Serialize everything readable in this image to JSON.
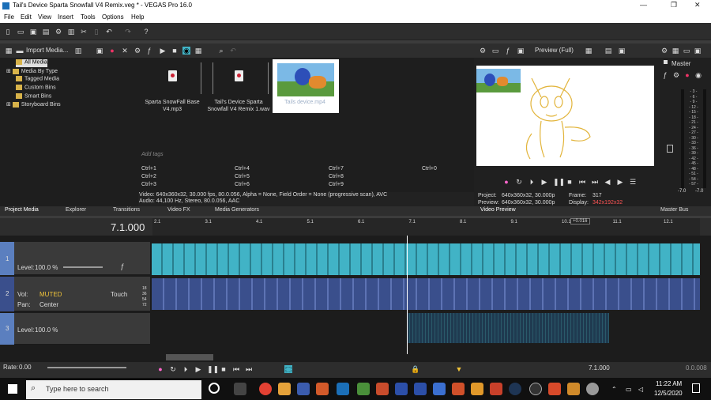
{
  "title": "Tail's Device Sparta Snowfall V4 Remix.veg * - VEGAS Pro 16.0",
  "menu": [
    "File",
    "Edit",
    "View",
    "Insert",
    "Tools",
    "Options",
    "Help"
  ],
  "project_media": {
    "import_label": "Import Media...",
    "tree": [
      "All Media",
      "Media By Type",
      "Tagged Media",
      "Custom Bins",
      "Smart Bins",
      "Storyboard Bins"
    ],
    "items": [
      {
        "name": "Sparta SnowFall Base V4.mp3"
      },
      {
        "name": "Tail's Device Sparta Snowfall V4 Remix 1.wav"
      },
      {
        "name": "Tails device.mp4"
      }
    ],
    "tags_placeholder": "Add tags",
    "shortcuts": [
      "Ctrl+1",
      "Ctrl+4",
      "Ctrl+7",
      "Ctrl+0",
      "Ctrl+2",
      "Ctrl+5",
      "Ctrl+8",
      "Ctrl+3",
      "Ctrl+6",
      "Ctrl+9"
    ],
    "info_video": "Video: 640x360x32, 30.000 fps, 80.0.056, Alpha = None, Field Order = None (progressive scan), AVC",
    "info_audio": "Audio: 44,100 Hz, Stereo, 80.0.056, AAC"
  },
  "tabs": [
    "Project Media",
    "Explorer",
    "Transitions",
    "Video FX",
    "Media Generators"
  ],
  "preview": {
    "mode": "Preview (Full)",
    "project_label": "Project:",
    "project_val": "640x360x32, 30.000p",
    "preview_label": "Preview:",
    "preview_val": "640x360x32, 30.000p",
    "frame_label": "Frame:",
    "frame_val": "317",
    "display_label": "Display:",
    "display_val": "342x192x32",
    "tab": "Video Preview"
  },
  "master": {
    "label": "Master",
    "tab": "Master Bus",
    "scale": [
      "3",
      "6",
      "9",
      "12",
      "15",
      "18",
      "21",
      "24",
      "27",
      "30",
      "33",
      "36",
      "39",
      "42",
      "45",
      "48",
      "51",
      "54",
      "57"
    ],
    "left": "-7.0",
    "right": "-7.0"
  },
  "timeline": {
    "time": "7.1.000",
    "marker": "+0.016",
    "ruler": [
      "2.1",
      "3.1",
      "4.1",
      "5.1",
      "6.1",
      "7.1",
      "8.1",
      "9.1",
      "10.1",
      "11.1",
      "12.1"
    ],
    "tracks": [
      {
        "num": "1",
        "level_label": "Level:",
        "level_val": "100.0 %"
      },
      {
        "num": "2",
        "vol_label": "Vol:",
        "vol_val": "MUTED",
        "pan_label": "Pan:",
        "pan_val": "Center",
        "mode": "Touch",
        "db": [
          "18",
          "36",
          "54",
          "72"
        ]
      },
      {
        "num": "3",
        "level_label": "Level:",
        "level_val": "100.0 %"
      }
    ]
  },
  "bottom": {
    "rate_label": "Rate:",
    "rate_val": "0.00",
    "time": "7.1.000",
    "end": "0.0.008"
  },
  "taskbar": {
    "search": "Type here to search",
    "time": "11:22 AM",
    "date": "12/5/2020"
  },
  "colors": {
    "accent": "#41b3c6",
    "muted": "#f0c33a",
    "display": "#ff5555",
    "audio": "#3a4f8c"
  }
}
